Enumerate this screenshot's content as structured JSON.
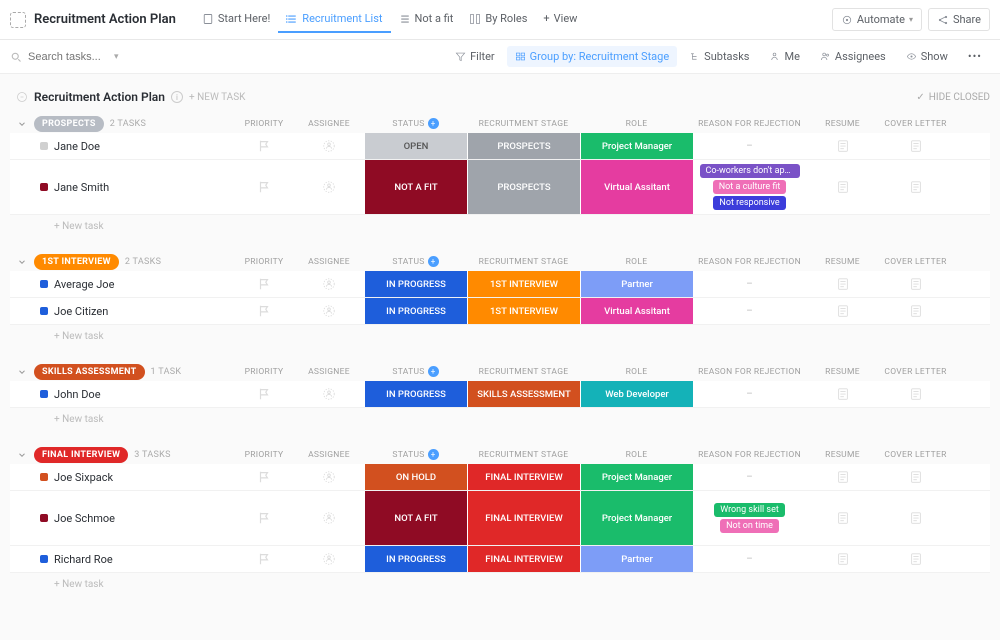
{
  "header": {
    "title": "Recruitment Action Plan",
    "tabs": [
      {
        "label": "Start Here!",
        "active": false
      },
      {
        "label": "Recruitment List",
        "active": true
      },
      {
        "label": "Not a fit",
        "active": false
      },
      {
        "label": "By Roles",
        "active": false
      },
      {
        "label": "View",
        "active": false
      }
    ],
    "automate": "Automate",
    "share": "Share"
  },
  "toolbar": {
    "search_placeholder": "Search tasks...",
    "filter": "Filter",
    "group_by": "Group by: Recruitment Stage",
    "subtasks": "Subtasks",
    "me": "Me",
    "assignees": "Assignees",
    "show": "Show"
  },
  "folder": {
    "title": "Recruitment Action Plan",
    "add_task": "+ NEW TASK",
    "hide_closed": "HIDE CLOSED"
  },
  "columns": {
    "priority": "PRIORITY",
    "assignee": "ASSIGNEE",
    "status": "STATUS",
    "recruitment_stage": "RECRUITMENT STAGE",
    "role": "ROLE",
    "reason_for_rejection": "REASON FOR REJECTION",
    "resume": "RESUME",
    "cover_letter": "COVER LETTER"
  },
  "new_task": "+ New task",
  "colors": {
    "stage_prospects": "#b7bcc4",
    "stage_1st": "#ff8a00",
    "stage_skills": "#d2501f",
    "stage_final": "#e02828",
    "status_open_bg": "#c9ccd1",
    "status_open_txt": "#555",
    "status_notafit": "#8f0b24",
    "status_inprogress": "#1e5edb",
    "status_onhold": "#d2501f",
    "stagecol_prospects": "#9fa4ab",
    "stagecol_1st": "#ff8a00",
    "stagecol_skills": "#d2501f",
    "stagecol_final": "#e02828",
    "role_pm": "#1abc6b",
    "role_va": "#e53ca0",
    "role_partner": "#7d9df7",
    "role_webdev": "#14b2b8",
    "tag_coworkers": "#7a52c7",
    "tag_culture": "#ef6fb7",
    "tag_notresp": "#3c3ddb",
    "tag_wrongskill": "#1abc6b",
    "tag_notontime": "#ef6fb7"
  },
  "groups": [
    {
      "name": "PROSPECTS",
      "pill_color": "stage_prospects",
      "count": "2 TASKS",
      "rows": [
        {
          "name": "Jane Doe",
          "sq": "#d0d0d0",
          "status": "OPEN",
          "status_key": "open",
          "stage": "PROSPECTS",
          "stage_key": "prospects",
          "role": "Project Manager",
          "role_key": "pm",
          "rejection": []
        },
        {
          "name": "Jane Smith",
          "sq": "#8f0b24",
          "tall": true,
          "status": "NOT A FIT",
          "status_key": "notafit",
          "stage": "PROSPECTS",
          "stage_key": "prospects",
          "role": "Virtual Assitant",
          "role_key": "va",
          "rejection": [
            {
              "label": "Co-workers don't appro...",
              "c": "tag_coworkers"
            },
            {
              "label": "Not a culture fit",
              "c": "tag_culture"
            },
            {
              "label": "Not responsive",
              "c": "tag_notresp"
            }
          ]
        }
      ]
    },
    {
      "name": "1ST INTERVIEW",
      "pill_color": "stage_1st",
      "count": "2 TASKS",
      "rows": [
        {
          "name": "Average Joe",
          "sq": "#1e5edb",
          "status": "IN PROGRESS",
          "status_key": "inprogress",
          "stage": "1ST INTERVIEW",
          "stage_key": "1st",
          "role": "Partner",
          "role_key": "partner",
          "rejection": []
        },
        {
          "name": "Joe Citizen",
          "sq": "#1e5edb",
          "status": "IN PROGRESS",
          "status_key": "inprogress",
          "stage": "1ST INTERVIEW",
          "stage_key": "1st",
          "role": "Virtual Assitant",
          "role_key": "va",
          "rejection": []
        }
      ]
    },
    {
      "name": "SKILLS ASSESSMENT",
      "pill_color": "stage_skills",
      "count": "1 TASK",
      "rows": [
        {
          "name": "John Doe",
          "sq": "#1e5edb",
          "status": "IN PROGRESS",
          "status_key": "inprogress",
          "stage": "SKILLS ASSESSMENT",
          "stage_key": "skills",
          "role": "Web Developer",
          "role_key": "webdev",
          "rejection": []
        }
      ]
    },
    {
      "name": "FINAL INTERVIEW",
      "pill_color": "stage_final",
      "count": "3 TASKS",
      "rows": [
        {
          "name": "Joe Sixpack",
          "sq": "#d2501f",
          "status": "ON HOLD",
          "status_key": "onhold",
          "stage": "FINAL INTERVIEW",
          "stage_key": "final",
          "role": "Project Manager",
          "role_key": "pm",
          "rejection": []
        },
        {
          "name": "Joe Schmoe",
          "sq": "#8f0b24",
          "tall": true,
          "status": "NOT A FIT",
          "status_key": "notafit",
          "stage": "FINAL INTERVIEW",
          "stage_key": "final",
          "role": "Project Manager",
          "role_key": "pm",
          "rejection": [
            {
              "label": "Wrong skill set",
              "c": "tag_wrongskill"
            },
            {
              "label": "Not on time",
              "c": "tag_notontime"
            }
          ]
        },
        {
          "name": "Richard Roe",
          "sq": "#1e5edb",
          "status": "IN PROGRESS",
          "status_key": "inprogress",
          "stage": "FINAL INTERVIEW",
          "stage_key": "final",
          "role": "Partner",
          "role_key": "partner",
          "rejection": []
        }
      ]
    }
  ]
}
